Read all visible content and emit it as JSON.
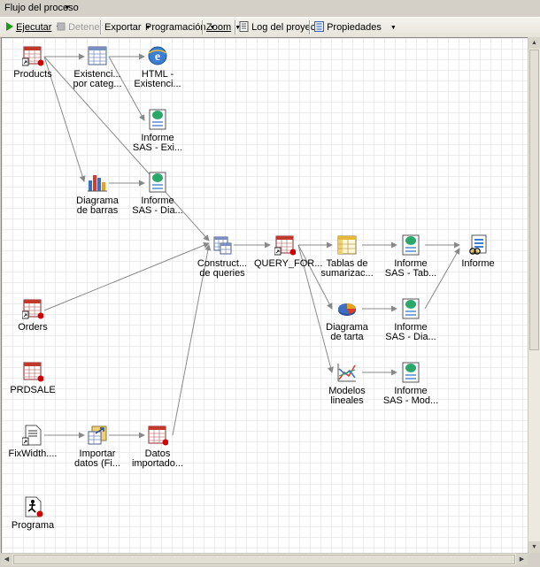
{
  "panel": {
    "title": "Flujo del proceso"
  },
  "toolbar": {
    "run": "Ejecutar",
    "stop": "Detener",
    "export": "Exportar",
    "schedule": "Programación",
    "zoom": "Zoom",
    "log": "Log del proyecto",
    "properties": "Propiedades"
  },
  "nodes": {
    "products": "Products",
    "existencias": "Existenci...\npor categ...",
    "html": "HTML -\nExistenci...",
    "informe_exi": "Informe\nSAS - Exi...",
    "barras": "Diagrama\nde barras",
    "informe_dia1": "Informe\nSAS - Dia...",
    "constructor": "Construct...\nde queries",
    "query": "QUERY_FOR...",
    "tablas": "Tablas de\nsumarizac...",
    "informe_tab": "Informe\nSAS - Tab...",
    "informe": "Informe",
    "tarta": "Diagrama\nde tarta",
    "informe_dia2": "Informe\nSAS - Dia...",
    "modelos": "Modelos\nlineales",
    "informe_mod": "Informe\nSAS - Mod...",
    "orders": "Orders",
    "prdsale": "PRDSALE",
    "fixwidth": "FixWidth....",
    "importar": "Importar\ndatos (Fi...",
    "datos": "Datos\nimportado...",
    "programa": "Programa"
  },
  "icons": {
    "run": "play-icon",
    "stop": "stop-icon",
    "log": "log-icon",
    "properties": "properties-icon",
    "table": "sas-table-icon",
    "task": "task-icon",
    "html": "html-report-icon",
    "report": "sas-report-icon",
    "bar": "bar-chart-icon",
    "pie": "pie-chart-icon",
    "line": "line-model-icon",
    "query": "query-builder-icon",
    "summary": "summary-table-icon",
    "text": "text-file-icon",
    "import": "import-data-icon",
    "program": "program-icon",
    "composite": "composite-report-icon"
  },
  "colors": {
    "grid": "#ececec",
    "wire": "#888888",
    "toolbar_top": "#f4f3ee"
  }
}
